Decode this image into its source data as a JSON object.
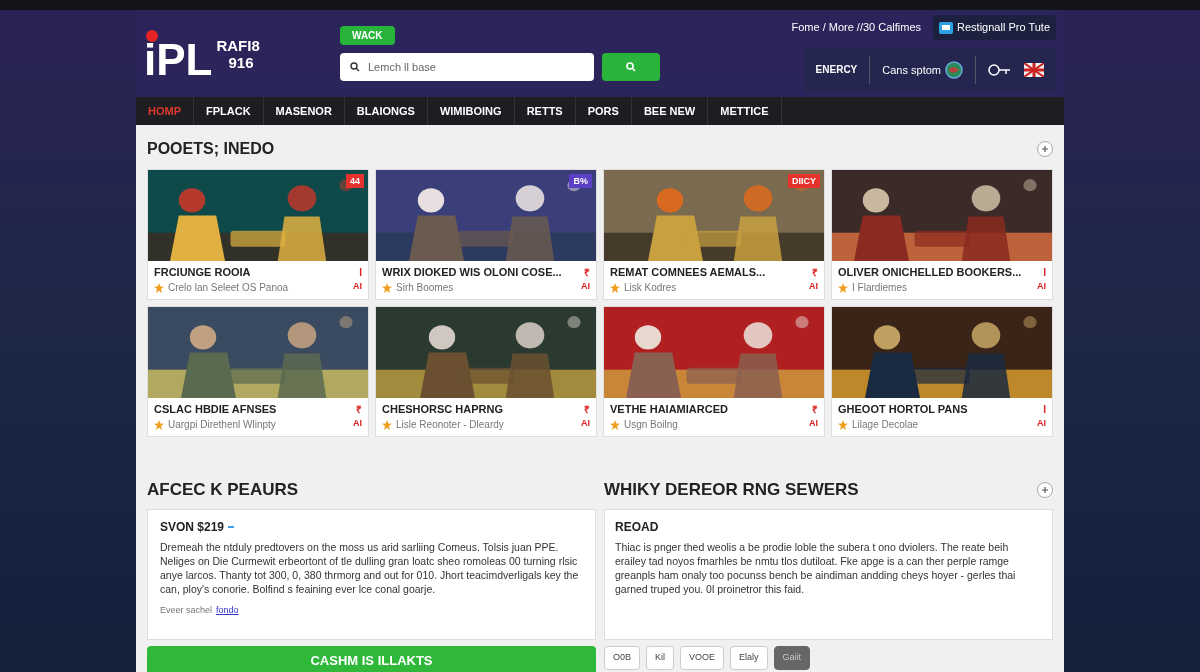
{
  "header": {
    "top_links": "Fome / More //30 Calfimes",
    "promo_button": "Restignall Pro Tute",
    "logo": {
      "mark": "iPL",
      "line_1": "RAFI8",
      "line_2": "916"
    },
    "badge": "WACK",
    "search": {
      "placeholder": "Lemch ll base"
    },
    "energy": {
      "label": "ENERCY"
    },
    "account": "Cans sptom"
  },
  "nav": [
    {
      "label": "HOMP",
      "selected": true
    },
    {
      "label": "FPLACK",
      "selected": false
    },
    {
      "label": "MASENOR",
      "selected": false
    },
    {
      "label": "BLAIONGS",
      "selected": false
    },
    {
      "label": "WIMIBOING",
      "selected": false
    },
    {
      "label": "RETTS",
      "selected": false
    },
    {
      "label": "PORS",
      "selected": false
    },
    {
      "label": "BEE NEW",
      "selected": false
    },
    {
      "label": "METTICE",
      "selected": false
    }
  ],
  "games_section": {
    "title": "POOETS; INEDO",
    "games": [
      {
        "title": "FRCIUNGE ROOIA",
        "subtitle": "Crelo lan Seleet OS Panoa",
        "badge": "44",
        "color": "#e5322d",
        "corner_top": "I",
        "corner_bottom": "AI"
      },
      {
        "title": "WRIX DIOKED WIS OLONI COSE...",
        "subtitle": "Sirh Boomes",
        "badge": "B%",
        "color": "#5b3fc4",
        "corner_top": "₹",
        "corner_bottom": "AI"
      },
      {
        "title": "REMAT COMNEES AEMALS...",
        "subtitle": "Lisk Kodres",
        "badge": "DIICY",
        "color": "#e5322d",
        "corner_top": "₹",
        "corner_bottom": "AI"
      },
      {
        "title": "OLIVER ONICHELLED BOOKERS...",
        "subtitle": "I Flardiemes",
        "corner_top": "I",
        "corner_bottom": "AI"
      },
      {
        "title": "CSLAC HBDIE AFNSES",
        "subtitle": "Uargpi Direthenl Wlinpty",
        "corner_top": "₹",
        "corner_bottom": "AI"
      },
      {
        "title": "CHESHORSC HAPRNG",
        "subtitle": "Lisle Reonoter - Dleardy",
        "corner_top": "₹",
        "corner_bottom": "AI"
      },
      {
        "title": "VETHE HAIAMIARCED",
        "subtitle": "Usgn Boilng",
        "corner_top": "₹",
        "corner_bottom": "AI"
      },
      {
        "title": "GHEOOT HORTOL PANS",
        "subtitle": "Lilage Decolae",
        "corner_top": "I",
        "corner_bottom": "AI"
      }
    ]
  },
  "left_section": {
    "title": "AFCEC K PEAURS",
    "card": {
      "heading": "SVON $219",
      "text": "Dremeah the ntduly predtovers on the moss us arid sarliing Comeus. Tolsis juan PPE. Neliges on Die Curmewit erbeortont of tle dulling gran loatc sheo romoleas 00 turning rlsic anye larcos. Thanty tot 300, 0, 380 thrmorg and out for 010. Jhort teacimdverligals key the can, ploy's conorie. Bolfind s feaining ever lce conal goarje.",
      "footer_text": "Eveer sachel",
      "footer_link": "fondo"
    },
    "button": "CASHM IS ILLAKTS"
  },
  "right_section": {
    "title": "WHIKY DEREOR RNG SEWERS",
    "card": {
      "heading": "REOAD",
      "text": "Thiac is pnger thed weolis a be prodie loble the subera t ono dviolers. The reate beih erailey tad noyos fmarhles be nmtu tlos dutiloat. Fke apge is a can ther perple ramge greanpls ham onaly too pocunss bench be aindiman andding cheys hoyer - gerles thai garned truped you. 0l proinetror this faid."
    },
    "pages": [
      {
        "label": "O0B",
        "selected": false
      },
      {
        "label": "Kil",
        "selected": false
      },
      {
        "label": "VOOE",
        "selected": false
      },
      {
        "label": "Elaly",
        "selected": false
      },
      {
        "label": "Gaiit",
        "selected": true
      }
    ]
  }
}
